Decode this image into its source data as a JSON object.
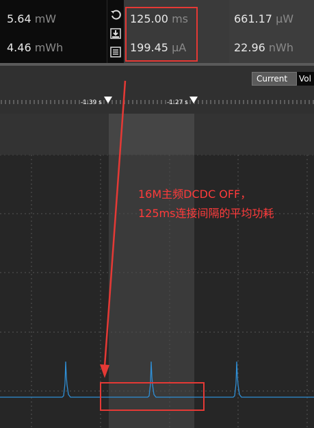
{
  "metrics": {
    "power": {
      "value": "5.64",
      "unit": "mW"
    },
    "energy": {
      "value": "4.46",
      "unit": "mWh"
    },
    "window_time": {
      "value": "125.00",
      "unit": "ms"
    },
    "window_avg_current": {
      "value": "199.45",
      "unit": "µA"
    },
    "window_power": {
      "value": "661.17",
      "unit": "µW"
    },
    "window_energy": {
      "value": "22.96",
      "unit": "nWh"
    }
  },
  "icons": {
    "reset": "reset-icon",
    "save": "save-download-icon",
    "log": "log-list-icon"
  },
  "toolbar": {
    "tab_current": "Current",
    "tab_voltage": "Vol"
  },
  "ruler": {
    "marker_left_label": "-1.39 s",
    "marker_right_label": "-1.27 s"
  },
  "annotation": {
    "line1": "16M主频DCDC OFF，",
    "line2": "125ms连接间隔的平均功耗"
  },
  "colors": {
    "annotation": "#ff3b3b",
    "trace": "#2f8fd6",
    "selection": "#4a4a4a"
  }
}
